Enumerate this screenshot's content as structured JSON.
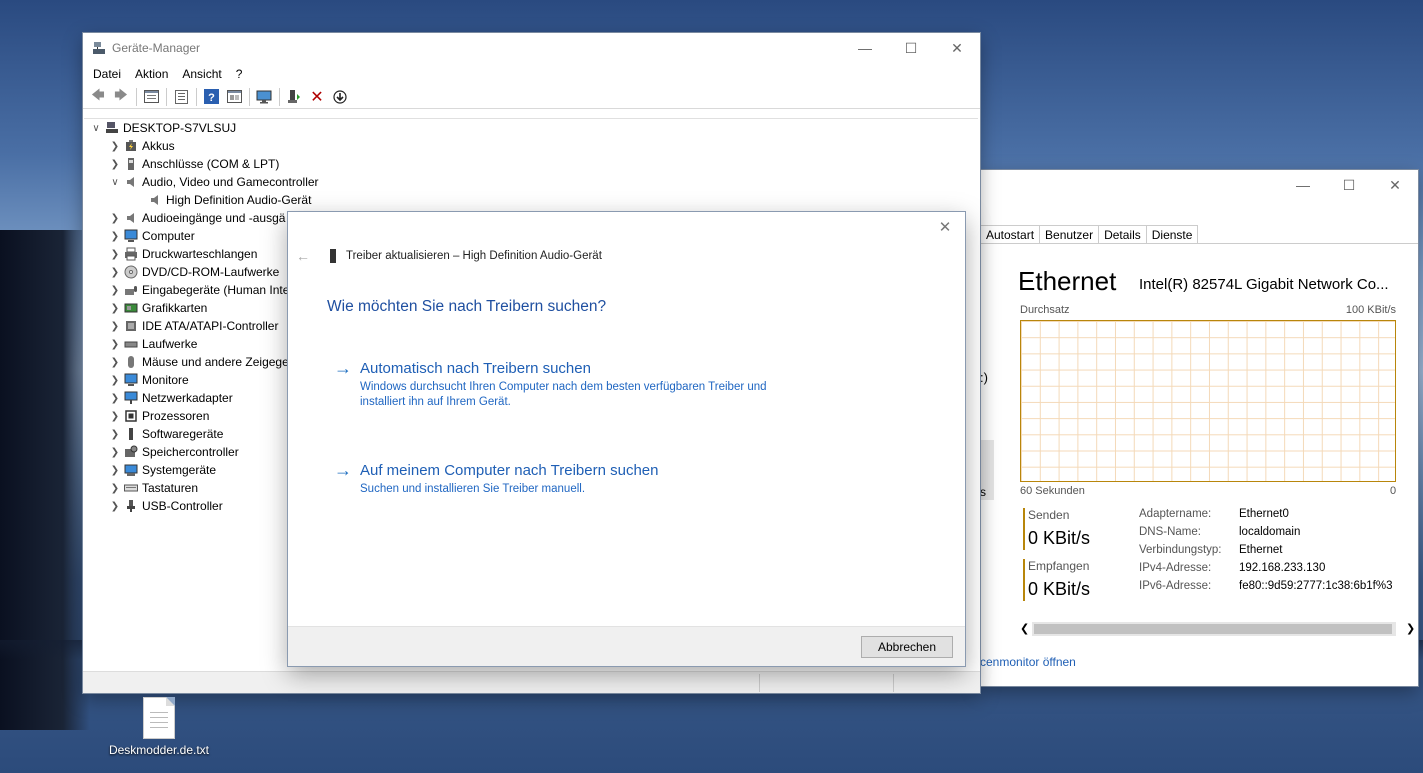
{
  "device_manager": {
    "title": "Geräte-Manager",
    "menu": [
      "Datei",
      "Aktion",
      "Ansicht",
      "?"
    ],
    "tree": {
      "root": "DESKTOP-S7VLSUJ",
      "items": [
        {
          "label": "Akkus",
          "expanded": false
        },
        {
          "label": "Anschlüsse (COM & LPT)",
          "expanded": false
        },
        {
          "label": "Audio, Video und Gamecontroller",
          "expanded": true
        },
        {
          "label": "High Definition Audio-Gerät",
          "child": true
        },
        {
          "label": "Audioeingänge und -ausgä",
          "expanded": false
        },
        {
          "label": "Computer",
          "expanded": false
        },
        {
          "label": "Druckwarteschlangen",
          "expanded": false
        },
        {
          "label": "DVD/CD-ROM-Laufwerke",
          "expanded": false
        },
        {
          "label": "Eingabegeräte (Human Inte",
          "expanded": false
        },
        {
          "label": "Grafikkarten",
          "expanded": false
        },
        {
          "label": "IDE ATA/ATAPI-Controller",
          "expanded": false
        },
        {
          "label": "Laufwerke",
          "expanded": false
        },
        {
          "label": "Mäuse und andere Zeigege",
          "expanded": false
        },
        {
          "label": "Monitore",
          "expanded": false
        },
        {
          "label": "Netzwerkadapter",
          "expanded": false
        },
        {
          "label": "Prozessoren",
          "expanded": false
        },
        {
          "label": "Softwaregeräte",
          "expanded": false
        },
        {
          "label": "Speichercontroller",
          "expanded": false
        },
        {
          "label": "Systemgeräte",
          "expanded": false
        },
        {
          "label": "Tastaturen",
          "expanded": false
        },
        {
          "label": "USB-Controller",
          "expanded": false
        }
      ]
    }
  },
  "task_manager": {
    "tabs": [
      "Autostart",
      "Benutzer",
      "Details",
      "Dienste"
    ],
    "heading": "Ethernet",
    "adapter_desc": "Intel(R) 82574L Gigabit Network Co...",
    "throughput_label": "Durchsatz",
    "scale_max": "100 KBit/s",
    "time_label": "60 Sekunden",
    "time_end": "0",
    "send_label": "Senden",
    "send_value": "0 KBit/s",
    "recv_label": "Empfangen",
    "recv_value": "0 KBit/s",
    "left_partial_1": ":)",
    "left_partial_2": "s",
    "props": [
      {
        "k": "Adaptername:",
        "v": "Ethernet0"
      },
      {
        "k": "DNS-Name:",
        "v": "localdomain"
      },
      {
        "k": "Verbindungstyp:",
        "v": "Ethernet"
      },
      {
        "k": "IPv4-Adresse:",
        "v": "192.168.233.130"
      },
      {
        "k": "IPv6-Adresse:",
        "v": "fe80::9d59:2777:1c38:6b1f%3"
      }
    ],
    "footer_link": "cenmonitor öffnen"
  },
  "dialog": {
    "title": "Treiber aktualisieren – High Definition Audio-Gerät",
    "question": "Wie möchten Sie nach Treibern suchen?",
    "option1_title": "Automatisch nach Treibern suchen",
    "option1_desc": "Windows durchsucht Ihren Computer nach dem besten verfügbaren Treiber und installiert ihn auf Ihrem Gerät.",
    "option2_title": "Auf meinem Computer nach Treibern suchen",
    "option2_desc": "Suchen und installieren Sie Treiber manuell.",
    "cancel": "Abbrechen"
  },
  "desktop": {
    "icon_label": "Deskmodder.de.txt"
  }
}
